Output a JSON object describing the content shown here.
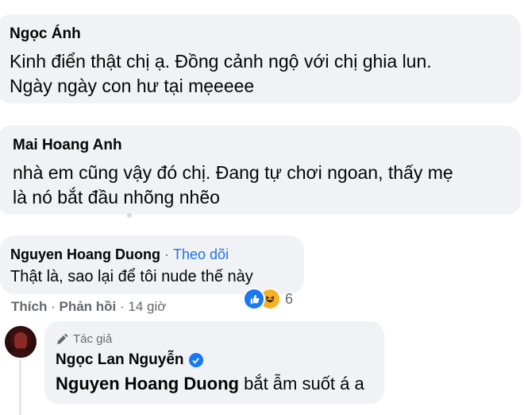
{
  "comments": [
    {
      "author": "Ngọc Ánh",
      "lines": [
        "Kinh điển thật chị ạ. Đồng cảnh ngộ với chị ghia lun.",
        "Ngày ngày con hư tại mẹeeee"
      ]
    },
    {
      "author": "Mai Hoang Anh",
      "lines": [
        "nhà em cũng vậy đó chị. Đang tự chơi ngoan, thấy mẹ",
        "là nó bắt đầu nhõng nhẽo"
      ]
    },
    {
      "author": "Nguyen Hoang Duong",
      "separator": "·",
      "follow_label": "Theo dõi",
      "lines": [
        "Thật là, sao lại để tôi nude thế này"
      ]
    }
  ],
  "actions": {
    "like": "Thích",
    "separator": "·",
    "reply": "Phản hồi",
    "time": "14 giờ"
  },
  "reactions": {
    "icons": [
      "like-icon",
      "haha-icon"
    ],
    "count": "6",
    "colors": {
      "like": "#1877f2",
      "haha": "#f7b125"
    }
  },
  "reply": {
    "badge": "Tác giả",
    "author": "Ngọc Lan Nguyễn",
    "mention": "Nguyen Hoang Duong",
    "text": " bắt ẫm suốt á a"
  },
  "colors": {
    "bubble": "#f0f2f5",
    "link": "#1b74e4",
    "secondary": "#65676b"
  }
}
